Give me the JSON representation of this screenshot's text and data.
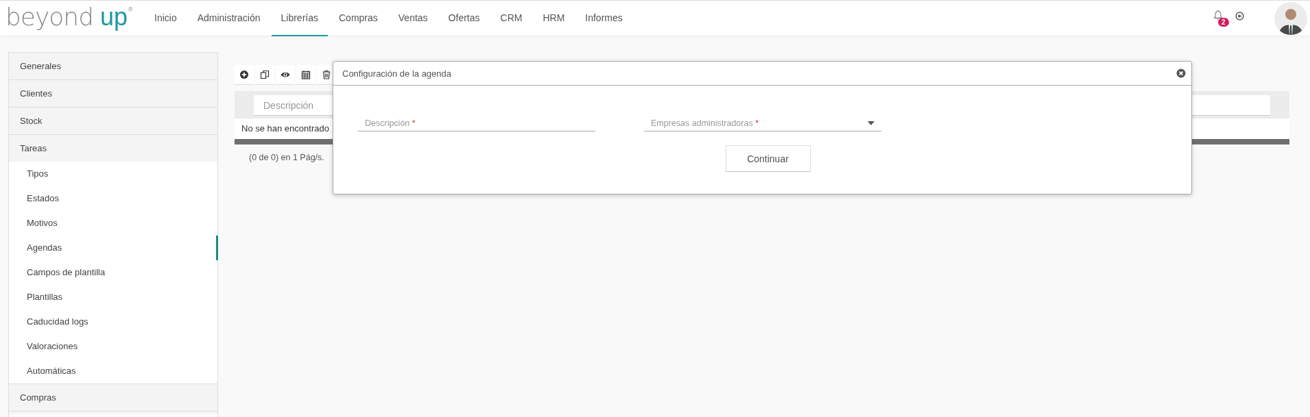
{
  "header": {
    "logo": {
      "word_1": "beyond",
      "word_2": "up",
      "mark": "®"
    },
    "nav": [
      {
        "label": "Inicio",
        "selected": false
      },
      {
        "label": "Administración",
        "selected": false
      },
      {
        "label": "Librerías",
        "selected": true
      },
      {
        "label": "Compras",
        "selected": false
      },
      {
        "label": "Ventas",
        "selected": false
      },
      {
        "label": "Ofertas",
        "selected": false
      },
      {
        "label": "CRM",
        "selected": false
      },
      {
        "label": "HRM",
        "selected": false
      },
      {
        "label": "Informes",
        "selected": false
      }
    ],
    "notifications": {
      "count": "2"
    }
  },
  "sidebar": {
    "sections": [
      {
        "label": "Generales",
        "expanded": false
      },
      {
        "label": "Clientes",
        "expanded": false
      },
      {
        "label": "Stock",
        "expanded": false
      },
      {
        "label": "Tareas",
        "expanded": true,
        "children": [
          {
            "label": "Tipos",
            "selected": false
          },
          {
            "label": "Estados",
            "selected": false
          },
          {
            "label": "Motivos",
            "selected": false
          },
          {
            "label": "Agendas",
            "selected": true
          },
          {
            "label": "Campos de plantilla",
            "selected": false
          },
          {
            "label": "Plantillas",
            "selected": false
          },
          {
            "label": "Caducidad logs",
            "selected": false
          },
          {
            "label": "Valoraciones",
            "selected": false
          },
          {
            "label": "Automáticas",
            "selected": false
          }
        ]
      },
      {
        "label": "Compras",
        "expanded": false
      }
    ]
  },
  "toolbar": [
    {
      "kind": "add"
    },
    {
      "kind": "copy"
    },
    {
      "kind": "view"
    },
    {
      "kind": "calendar"
    },
    {
      "kind": "delete"
    }
  ],
  "table": {
    "filter": {
      "placeholder": "Descripción"
    },
    "empty_message": "No se han encontrado",
    "pager": "(0 de 0) en 1 Pág/s."
  },
  "dialog": {
    "title": "Configuración de la agenda",
    "fields": [
      {
        "kind": "text",
        "label": "Descripción",
        "required_mark": "*"
      },
      {
        "kind": "select",
        "label": "Empresas administradoras",
        "required_mark": "*"
      }
    ],
    "button": "Continuar"
  }
}
